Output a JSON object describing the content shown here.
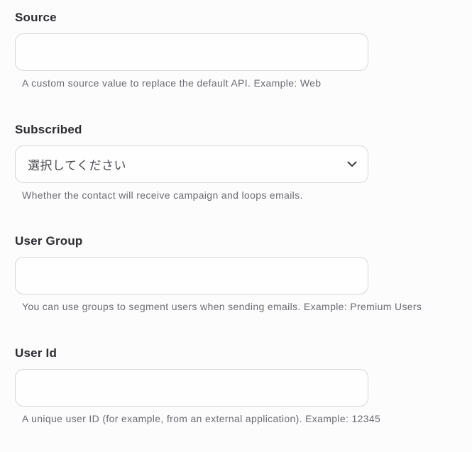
{
  "fields": [
    {
      "label": "Source",
      "type": "text",
      "value": "",
      "help": "A custom source value to replace the default API. Example: Web"
    },
    {
      "label": "Subscribed",
      "type": "select",
      "selected": "選択してください",
      "icon": "chevron-down-icon",
      "help": "Whether the contact will receive campaign and loops emails."
    },
    {
      "label": "User Group",
      "type": "text",
      "value": "",
      "help": "You can use groups to segment users when sending emails. Example: Premium Users"
    },
    {
      "label": "User Id",
      "type": "text",
      "value": "",
      "help": "A unique user ID (for example, from an external application). Example: 12345"
    }
  ],
  "colors": {
    "background": "#fcfcfd",
    "border": "#d6d6dc",
    "label": "#2b2b30",
    "help": "#6b6b73"
  }
}
